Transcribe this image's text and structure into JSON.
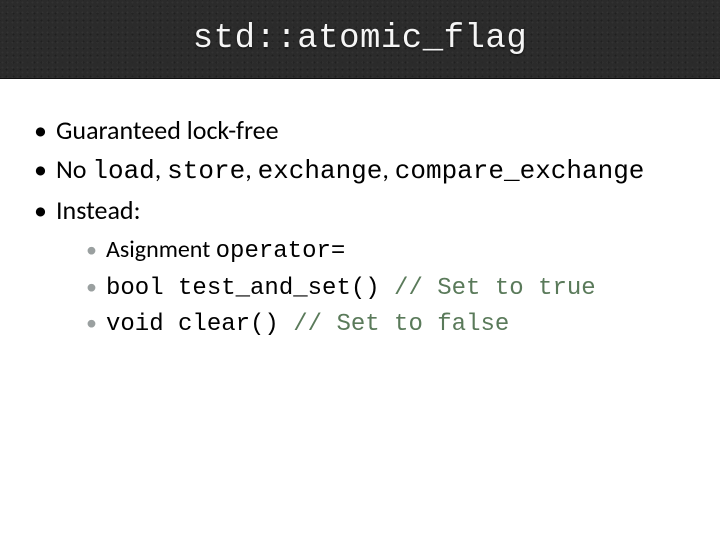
{
  "title": "std::atomic_flag",
  "bullets": {
    "b1": "Guaranteed lock-free",
    "b2_prefix": "No ",
    "b2_code": "load",
    "b2_mid1": ", ",
    "b2_code2": "store",
    "b2_mid2": ", ",
    "b2_code3": "exchange",
    "b2_mid3": ", ",
    "b2_code4": "compare_exchange",
    "b3": "Instead:"
  },
  "sub": {
    "s1_prefix": "Asignment ",
    "s1_code": "operator=",
    "s2_code": "bool test_and_set() ",
    "s2_comment": "// Set to true",
    "s3_code": "void clear() ",
    "s3_comment": "// Set to false"
  }
}
